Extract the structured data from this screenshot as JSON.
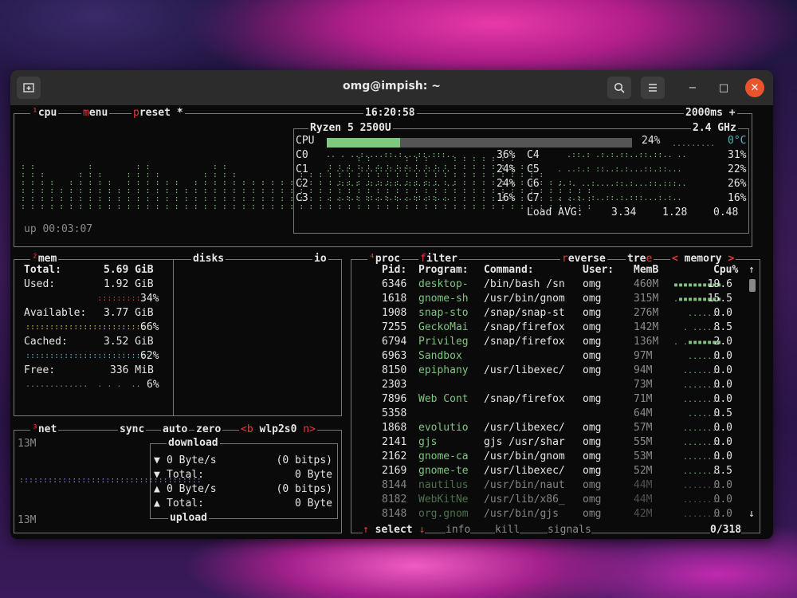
{
  "window": {
    "title": "omg@impish: ~",
    "new_tab_icon": "new-tab-icon",
    "search_icon": "search-icon",
    "menu_icon": "hamburger-menu-icon",
    "minimize": "−",
    "maximize": "□",
    "close": "✕"
  },
  "cpu": {
    "label_prefix": "¹",
    "label": "cpu",
    "menu_m": "m",
    "menu_rest": "enu",
    "preset_p": "p",
    "preset_rest": "reset *",
    "clock": "16:20:58",
    "interval": "2000ms +",
    "model": "Ryzen 5 2500U",
    "freq": "2.4 GHz",
    "total_label": "CPU",
    "total_pct": "24%",
    "total_value": 0.24,
    "temp": "0°C",
    "cores_left": [
      {
        "name": "C0",
        "pct": "36%"
      },
      {
        "name": "C1",
        "pct": "24%"
      },
      {
        "name": "C2",
        "pct": "24%"
      },
      {
        "name": "C3",
        "pct": "16%"
      }
    ],
    "cores_right": [
      {
        "name": "C4",
        "pct": "31%"
      },
      {
        "name": "C5",
        "pct": "22%"
      },
      {
        "name": "C6",
        "pct": "26%"
      },
      {
        "name": "C7",
        "pct": "16%"
      }
    ],
    "load_label": "Load AVG:",
    "load": [
      "3.34",
      "1.28",
      "0.48"
    ],
    "uptime": "up 00:03:07"
  },
  "mem": {
    "label_prefix": "²",
    "label": "mem",
    "disks": "disks",
    "io": "io",
    "total_label": "Total:",
    "total": "5.69 GiB",
    "used_label": "Used:",
    "used": "1.92 GiB",
    "used_pct": "34%",
    "avail_label": "Available:",
    "avail": "3.77 GiB",
    "avail_pct": "66%",
    "cached_label": "Cached:",
    "cached": "3.52 GiB",
    "cached_pct": "62%",
    "free_label": "Free:",
    "free": "336 MiB",
    "free_pct": "6%"
  },
  "net": {
    "label_prefix": "³",
    "label": "net",
    "sync": "sync",
    "auto": "auto",
    "zero": "zero",
    "iface_b": "<b",
    "iface": "wlp2s0",
    "iface_n": "n>",
    "top_scale": "13M",
    "bottom_scale": "13M",
    "download": "download",
    "upload": "upload",
    "rows": [
      {
        "arrow": "▼",
        "label": "0 Byte/s",
        "value": "(0 bitps)"
      },
      {
        "arrow": "▼",
        "label": "Total:",
        "value": "0 Byte"
      },
      {
        "arrow": "▲",
        "label": "0 Byte/s",
        "value": "(0 bitps)"
      },
      {
        "arrow": "▲",
        "label": "Total:",
        "value": "0 Byte"
      }
    ]
  },
  "proc": {
    "label_prefix": "⁴",
    "label": "proc",
    "filter_f": "f",
    "filter_rest": "ilter",
    "reverse_r": "r",
    "reverse_rest": "everse",
    "tree": "tre",
    "tree_e": "e",
    "sort": "< memory >",
    "headers": {
      "pid": "Pid:",
      "program": "Program:",
      "command": "Command:",
      "user": "User:",
      "mem": "MemB",
      "cpu": "Cpu%"
    },
    "rows": [
      {
        "pid": "6346",
        "program": "desktop-",
        "command": "/bin/bash /sn",
        "user": "omg",
        "mem": "460M",
        "cpu": "19.6"
      },
      {
        "pid": "1618",
        "program": "gnome-sh",
        "command": "/usr/bin/gnom",
        "user": "omg",
        "mem": "315M",
        "cpu": "15.5"
      },
      {
        "pid": "1908",
        "program": "snap-sto",
        "command": "/snap/snap-st",
        "user": "omg",
        "mem": "276M",
        "cpu": "0.0"
      },
      {
        "pid": "7255",
        "program": "GeckoMai",
        "command": "/snap/firefox",
        "user": "omg",
        "mem": "142M",
        "cpu": "8.5"
      },
      {
        "pid": "6794",
        "program": "Privileg",
        "command": "/snap/firefox",
        "user": "omg",
        "mem": "136M",
        "cpu": "2.0"
      },
      {
        "pid": "6963",
        "program": "Sandbox",
        "command": "",
        "user": "omg",
        "mem": "97M",
        "cpu": "0.0"
      },
      {
        "pid": "8150",
        "program": "epiphany",
        "command": "/usr/libexec/",
        "user": "omg",
        "mem": "94M",
        "cpu": "0.0"
      },
      {
        "pid": "2303",
        "program": "",
        "command": "",
        "user": "",
        "mem": "73M",
        "cpu": "0.0"
      },
      {
        "pid": "7896",
        "program": "Web Cont",
        "command": "/snap/firefox",
        "user": "omg",
        "mem": "71M",
        "cpu": "0.0"
      },
      {
        "pid": "5358",
        "program": "",
        "command": "",
        "user": "",
        "mem": "64M",
        "cpu": "0.5"
      },
      {
        "pid": "1868",
        "program": "evolutio",
        "command": "/usr/libexec/",
        "user": "omg",
        "mem": "57M",
        "cpu": "0.0"
      },
      {
        "pid": "2141",
        "program": "gjs",
        "command": "gjs /usr/shar",
        "user": "omg",
        "mem": "55M",
        "cpu": "0.0"
      },
      {
        "pid": "2162",
        "program": "gnome-ca",
        "command": "/usr/bin/gnom",
        "user": "omg",
        "mem": "53M",
        "cpu": "0.0"
      },
      {
        "pid": "2169",
        "program": "gnome-te",
        "command": "/usr/libexec/",
        "user": "omg",
        "mem": "52M",
        "cpu": "8.5"
      },
      {
        "pid": "8144",
        "program": "nautilus",
        "command": "/usr/bin/naut",
        "user": "omg",
        "mem": "44M",
        "cpu": "0.0"
      },
      {
        "pid": "8182",
        "program": "WebKitNe",
        "command": "/usr/lib/x86_",
        "user": "omg",
        "mem": "44M",
        "cpu": "0.0"
      },
      {
        "pid": "8148",
        "program": "org.gnom",
        "command": "/usr/bin/gjs",
        "user": "omg",
        "mem": "42M",
        "cpu": "0.0"
      }
    ],
    "footer": {
      "up": "↑",
      "select": "select",
      "down": "↓",
      "info": "info",
      "kill_k": "k",
      "kill": "kill",
      "signals": "signals",
      "count": "0/318"
    }
  },
  "colors": {
    "accent_red": "#e23b3b",
    "graph_green": "#7fc47f",
    "cached_cyan": "#4fb3c7",
    "used_red": "#c84040",
    "avail_yellow": "#e0b84a"
  }
}
